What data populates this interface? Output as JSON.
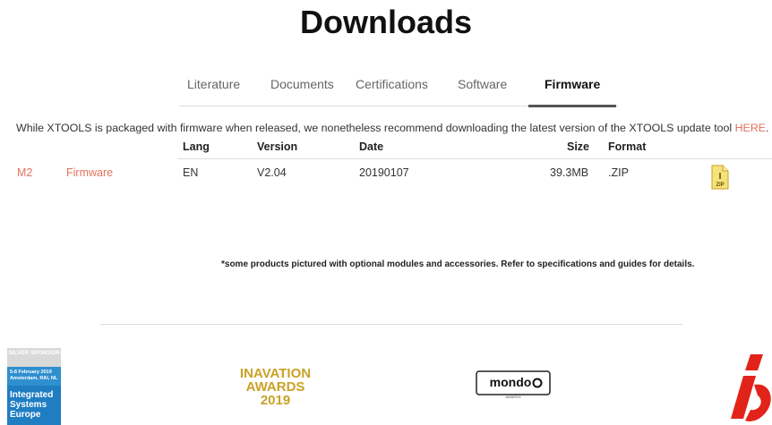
{
  "page": {
    "title": "Downloads"
  },
  "tabs": [
    "Literature",
    "Documents",
    "Certifications",
    "Software",
    "Firmware"
  ],
  "notice": {
    "text": "While XTOOLS is packaged with firmware when released, we nonetheless recommend downloading the latest version of the XTOOLS update tool ",
    "link": "HERE",
    "end": "."
  },
  "table": {
    "headers": {
      "lang": "Lang",
      "version": "Version",
      "date": "Date",
      "size": "Size",
      "format": "Format"
    },
    "rows": [
      {
        "model": "M2",
        "type": "Firmware",
        "lang": "EN",
        "version": "V2.04",
        "date": "20190107",
        "size": "39.3MB",
        "format": ".ZIP",
        "icon": "zip-file-icon"
      }
    ]
  },
  "footnote": "*some products pictured with optional modules and accessories. Refer to specifications and guides for details.",
  "sponsors": {
    "ise": {
      "badge": "SILVER SPONSOR",
      "dates": "5-8 February 2019",
      "venue": "Amsterdam, RAI, NL",
      "line1": "Integrated",
      "line2": "Systems",
      "line3": "Europe"
    },
    "inavation": {
      "line1": "INAVATION",
      "line2": "AWARDS",
      "line3": "2019"
    },
    "mondo": {
      "name": "mondo",
      "sub": "AWARDS"
    }
  },
  "colors": {
    "accent": "#e2715d",
    "ise_blue": "#1f7dc2",
    "gold": "#c9a227",
    "ibc_red": "#e2231a"
  }
}
